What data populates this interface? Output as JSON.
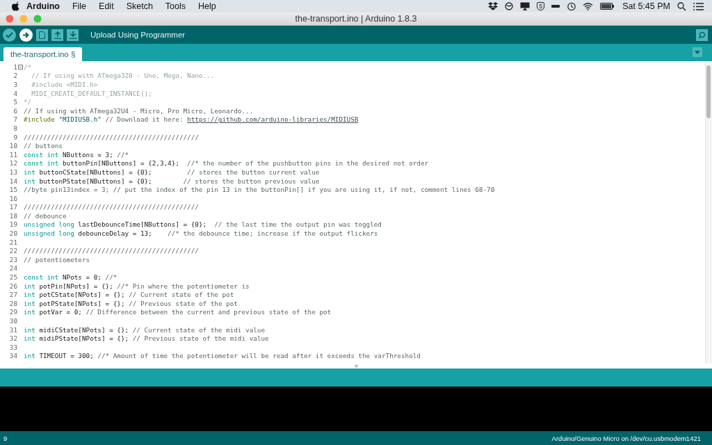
{
  "menubar": {
    "app": "Arduino",
    "menus": [
      "File",
      "Edit",
      "Sketch",
      "Tools",
      "Help"
    ],
    "badge": "5",
    "clock": "Sat 5:45 PM"
  },
  "window": {
    "title": "the-transport.ino | Arduino 1.8.3"
  },
  "toolbar": {
    "hint": "Upload Using Programmer"
  },
  "tabs": [
    {
      "label": "the-transport.ino §",
      "selected": true
    }
  ],
  "editor": {
    "lines": [
      {
        "num": "1",
        "fold": true,
        "segments": [
          {
            "kind": "block_comment",
            "text": "/*"
          }
        ]
      },
      {
        "num": "2",
        "fold": false,
        "segments": [
          {
            "kind": "block_comment",
            "text": "  // If using with ATmega328 - Uno, Mega, Nano..."
          }
        ]
      },
      {
        "num": "3",
        "fold": false,
        "segments": [
          {
            "kind": "block_comment",
            "text": "  #include <MIDI.h>"
          }
        ]
      },
      {
        "num": "4",
        "fold": false,
        "segments": [
          {
            "kind": "block_comment",
            "text": "  MIDI_CREATE_DEFAULT_INSTANCE();"
          }
        ]
      },
      {
        "num": "5",
        "fold": false,
        "segments": [
          {
            "kind": "block_comment",
            "text": "*/"
          }
        ]
      },
      {
        "num": "6",
        "fold": false,
        "segments": [
          {
            "kind": "comment",
            "text": "// If using with ATmega32U4 - Micro, Pro Micro, Leonardo..."
          }
        ]
      },
      {
        "num": "7",
        "fold": false,
        "segments": [
          {
            "kind": "preprocessor",
            "text": "#include"
          },
          {
            "kind": "string",
            "text": " \"MIDIUSB.h\""
          },
          {
            "kind": "comment",
            "text": " // Download it here: "
          },
          {
            "kind": "link",
            "text": "https://github.com/arduino-libraries/MIDIUSB"
          }
        ]
      },
      {
        "num": "8",
        "fold": false
      },
      {
        "num": "9",
        "fold": false,
        "segments": [
          {
            "kind": "comment",
            "text": "/////////////////////////////////////////////"
          }
        ]
      },
      {
        "num": "10",
        "fold": false,
        "segments": [
          {
            "kind": "comment",
            "text": "// buttons"
          }
        ]
      },
      {
        "num": "11",
        "fold": false,
        "segments": [
          {
            "kind": "keyword",
            "text": "const int"
          },
          {
            "kind": "plain",
            "text": " NButtons = 3; "
          },
          {
            "kind": "comment",
            "text": "//*"
          }
        ]
      },
      {
        "num": "12",
        "fold": false,
        "segments": [
          {
            "kind": "keyword",
            "text": "const int"
          },
          {
            "kind": "plain",
            "text": " buttonPin[NButtons] = {2,3,4};  "
          },
          {
            "kind": "comment",
            "text": "//* the number of the pushbutton pins in the desired not order"
          }
        ]
      },
      {
        "num": "13",
        "fold": false,
        "segments": [
          {
            "kind": "keyword",
            "text": "int"
          },
          {
            "kind": "plain",
            "text": " buttonCState[NButtons] = {0};         "
          },
          {
            "kind": "comment",
            "text": "// stores the button current value"
          }
        ]
      },
      {
        "num": "14",
        "fold": false,
        "segments": [
          {
            "kind": "keyword",
            "text": "int"
          },
          {
            "kind": "plain",
            "text": " buttonPState[NButtons] = {0};        "
          },
          {
            "kind": "comment",
            "text": "// stores the button previous value"
          }
        ]
      },
      {
        "num": "15",
        "fold": false,
        "segments": [
          {
            "kind": "comment",
            "text": "//byte pin13index = 3; // put the index of the pin 13 in the buttonPin[] if you are using it, if not, comment lines 68-70"
          }
        ]
      },
      {
        "num": "16",
        "fold": false
      },
      {
        "num": "17",
        "fold": false,
        "segments": [
          {
            "kind": "comment",
            "text": "/////////////////////////////////////////////"
          }
        ]
      },
      {
        "num": "18",
        "fold": false,
        "segments": [
          {
            "kind": "comment",
            "text": "// debounce"
          }
        ]
      },
      {
        "num": "19",
        "fold": false,
        "segments": [
          {
            "kind": "keyword",
            "text": "unsigned long"
          },
          {
            "kind": "plain",
            "text": " lastDebounceTime[NButtons] = {0};  "
          },
          {
            "kind": "comment",
            "text": "// the last time the output pin was toggled"
          }
        ]
      },
      {
        "num": "20",
        "fold": false,
        "segments": [
          {
            "kind": "keyword",
            "text": "unsigned long"
          },
          {
            "kind": "plain",
            "text": " debounceDelay = 13;    "
          },
          {
            "kind": "comment",
            "text": "//* the debounce time; increase if the output flickers"
          }
        ]
      },
      {
        "num": "21",
        "fold": false
      },
      {
        "num": "22",
        "fold": false,
        "segments": [
          {
            "kind": "comment",
            "text": "/////////////////////////////////////////////"
          }
        ]
      },
      {
        "num": "23",
        "fold": false,
        "segments": [
          {
            "kind": "comment",
            "text": "// potentiometers"
          }
        ]
      },
      {
        "num": "24",
        "fold": false
      },
      {
        "num": "25",
        "fold": false,
        "segments": [
          {
            "kind": "keyword",
            "text": "const int"
          },
          {
            "kind": "plain",
            "text": " NPots = 0; "
          },
          {
            "kind": "comment",
            "text": "//*"
          }
        ]
      },
      {
        "num": "26",
        "fold": false,
        "segments": [
          {
            "kind": "keyword",
            "text": "int"
          },
          {
            "kind": "plain",
            "text": " potPin[NPots] = {}; "
          },
          {
            "kind": "comment",
            "text": "//* Pin where the potentiometer is"
          }
        ]
      },
      {
        "num": "27",
        "fold": false,
        "segments": [
          {
            "kind": "keyword",
            "text": "int"
          },
          {
            "kind": "plain",
            "text": " potCState[NPots] = {}; "
          },
          {
            "kind": "comment",
            "text": "// Current state of the pot"
          }
        ]
      },
      {
        "num": "28",
        "fold": false,
        "segments": [
          {
            "kind": "keyword",
            "text": "int"
          },
          {
            "kind": "plain",
            "text": " potPState[NPots] = {}; "
          },
          {
            "kind": "comment",
            "text": "// Previous state of the pot"
          }
        ]
      },
      {
        "num": "29",
        "fold": false,
        "segments": [
          {
            "kind": "keyword",
            "text": "int"
          },
          {
            "kind": "plain",
            "text": " potVar = 0; "
          },
          {
            "kind": "comment",
            "text": "// Difference between the current and previous state of the pot"
          }
        ]
      },
      {
        "num": "30",
        "fold": false
      },
      {
        "num": "31",
        "fold": false,
        "segments": [
          {
            "kind": "keyword",
            "text": "int"
          },
          {
            "kind": "plain",
            "text": " midiCState[NPots] = {}; "
          },
          {
            "kind": "comment",
            "text": "// Current state of the midi value"
          }
        ]
      },
      {
        "num": "32",
        "fold": false,
        "segments": [
          {
            "kind": "keyword",
            "text": "int"
          },
          {
            "kind": "plain",
            "text": " midiPState[NPots] = {}; "
          },
          {
            "kind": "comment",
            "text": "// Previous state of the midi value"
          }
        ]
      },
      {
        "num": "33",
        "fold": false
      },
      {
        "num": "34",
        "fold": false,
        "segments": [
          {
            "kind": "keyword",
            "text": "int"
          },
          {
            "kind": "plain",
            "text": " TIMEOUT = 300; "
          },
          {
            "kind": "comment",
            "text": "//* Amount of time the potentiometer will be read after it exceeds the varThreshold"
          }
        ]
      }
    ]
  },
  "status_bar": {
    "line": "9",
    "board": "Arduino/Genuino Micro on /dev/cu.usbmodem1421"
  }
}
